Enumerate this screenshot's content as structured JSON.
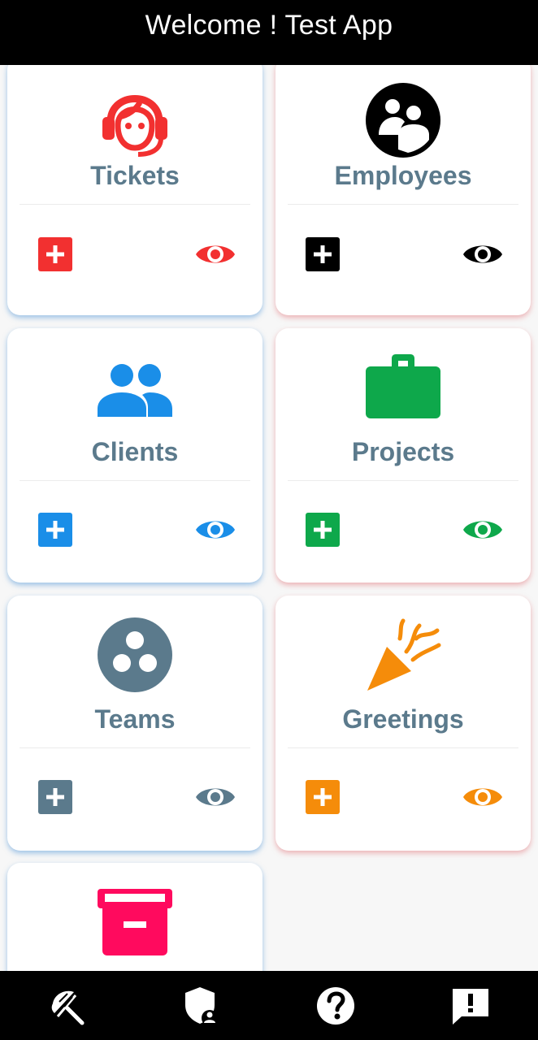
{
  "header": {
    "title": "Welcome ! Test App"
  },
  "cards": [
    {
      "label": "Tickets",
      "color": "#f23030",
      "icon": "headset-icon"
    },
    {
      "label": "Employees",
      "color": "#000000",
      "icon": "group-circle-icon"
    },
    {
      "label": "Clients",
      "color": "#1a8ee8",
      "icon": "people-icon"
    },
    {
      "label": "Projects",
      "color": "#0ea84b",
      "icon": "briefcase-icon"
    },
    {
      "label": "Teams",
      "color": "#5b7a8c",
      "icon": "workspaces-icon"
    },
    {
      "label": "Greetings",
      "color": "#f58c0a",
      "icon": "party-popper-icon"
    },
    {
      "label": "",
      "color": "#ff0a5e",
      "icon": "archive-box-icon"
    }
  ],
  "bottom_nav": [
    "umbrella-beach-icon",
    "shield-user-icon",
    "help-circle-icon",
    "feedback-icon"
  ]
}
